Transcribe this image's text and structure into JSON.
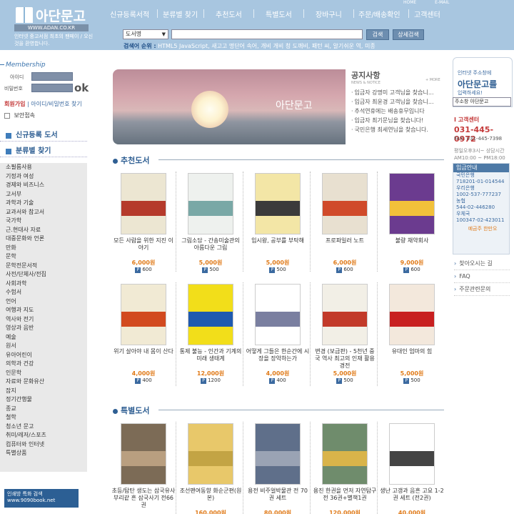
{
  "header": {
    "logo_text": "아단문고",
    "logo_url": "WWW.ADAN.CO.KR",
    "logo_desc": "인터넷 중고서점 최초의 팬페이 / 오신 것을 환영합니다.",
    "top_links": [
      "HOME",
      "E-MAIL"
    ],
    "nav": [
      "신규등록서적",
      "분류별 찾기",
      "추천도서",
      "특별도서",
      "장바구니",
      "주문/배송확인",
      "고객센터"
    ],
    "search_select": "도서명",
    "search_button": "검색",
    "detail_button": "상세검색",
    "popular_label": "검색어 순위 :",
    "popular_terms": "HTML5 JavaScript, 새고고 명단어 속어, 개비 개비 청 도깨비, 패턴 씨, 알기쉬운 역, 미종"
  },
  "left": {
    "membership": "Membership",
    "id_label": "아이디",
    "pw_label": "비밀번호",
    "ok": "ok",
    "join": "회원가입",
    "find": "| 아이디/비밀번호 찾기",
    "secure": "보안접속",
    "menu_new": "신규등록 도서",
    "menu_cat": "분류별 찾기",
    "categories": [
      "소필름사용",
      "기정과 여성",
      "경제와 비즈니스",
      "고서부",
      "과학과 기술",
      "교과서와 참고서",
      "국가학",
      "근.현대사 자료",
      "대중문화와 언론",
      "만화",
      "문학",
      "문학전문서적",
      "사전/단체사/전집",
      "사회과학",
      "수험서",
      "언어",
      "여행과 지도",
      "역사와 전기",
      "영상과 음반",
      "예술",
      "원서",
      "유아어린이",
      "의학과 건강",
      "인문학",
      "자료와 문화유산",
      "잡지",
      "정기간행물",
      "종교",
      "철학",
      "청소년 문고",
      "취미/레저/스포츠",
      "컴퓨터와 인터넷",
      "특별상품"
    ],
    "banner": "인쇄방 특화 검색 www.9090book.net"
  },
  "main": {
    "photo_title": "아단문고",
    "notice_title": "공지사항",
    "notice_sub": "NEWS & NOTICE",
    "more": "+ MORE",
    "notices": [
      "입금자 강명미 고객님을 찾습니...",
      "입금자 최윤경 고객님을 찾습니...",
      "추석연휴에는 배송휴무입니다",
      "입금자 최기문님을 찾습니다!",
      "국민은행 최세연님을 찾습니다."
    ],
    "rec_title": "추천도서",
    "special_title": "특별도서",
    "rec_books": [
      {
        "title": "모든 사람을 위한 지진 이야기",
        "price": "6,000원",
        "point": "600"
      },
      {
        "title": "그림소담 - 간송미술관의 아름다운 그림",
        "price": "5,000원",
        "point": "500"
      },
      {
        "title": "입시왕, 공부를 부탁해",
        "price": "5,000원",
        "point": "500"
      },
      {
        "title": "프로파일러 노트",
        "price": "6,000원",
        "point": "600"
      },
      {
        "title": "불량 채약회사",
        "price": "9,000원",
        "point": "600"
      },
      {
        "title": "위기 살아야 내 몸이 산다",
        "price": "4,000원",
        "point": "400"
      },
      {
        "title": "통제 불능 - 인간과 기계의 미래 생태계",
        "price": "12,000원",
        "point": "1200"
      },
      {
        "title": "어떻게 그들은 한순간에 시장을 장악하는가",
        "price": "4,000원",
        "point": "400"
      },
      {
        "title": "변경 (보급판) - 5천년 중국 역사 최고의 인재 활용 경전",
        "price": "5,000원",
        "point": "500"
      },
      {
        "title": "유대인 엄마의 힘",
        "price": "5,000원",
        "point": "500"
      }
    ],
    "special_books": [
      {
        "title": "초등/탐탄 생도는 삼국유사 부리같 흔 삼국사기 전66권",
        "price": "",
        "point": ""
      },
      {
        "title": "조선팬여동향 화순군편(원본)",
        "price": "160,000원",
        "point": ""
      },
      {
        "title": "용전 비주얼박물관 전 70권 세트",
        "price": "80,000원",
        "point": ""
      },
      {
        "title": "용진 한권을 먼저 자연탐구전 36권+별책1권",
        "price": "120,000원",
        "point": ""
      },
      {
        "title": "생난 고갱과 음흔 고요 1-2권 세트 (전2권)",
        "price": "40,000원",
        "point": ""
      }
    ]
  },
  "right": {
    "tag1": "인터넷 주소창에",
    "tag2": "아단문고를",
    "tag3": "입력하세요!",
    "select": "주소창 아단문고",
    "cs": "I 고객센터",
    "tel": "031-445-0972",
    "fax": "FAX: 031-445-7398",
    "hours": "평일오후3시~ 상담시간 AM10:00 ~ PM18:00",
    "bank_h": "입금안내",
    "bank_lines": [
      "국민은행",
      "718201-01-014544",
      "우리은행",
      "1002-537-777237",
      "농협",
      "544-02-446280",
      "우체국",
      "100347-02-423011"
    ],
    "owner": "예금주 한만오",
    "links": [
      "찾아오시는 길",
      "FAQ",
      "주문관련문의"
    ]
  },
  "colors": {
    "accent": "#2f5f93",
    "price": "#e07b1a",
    "header": "#a8c6e0"
  }
}
